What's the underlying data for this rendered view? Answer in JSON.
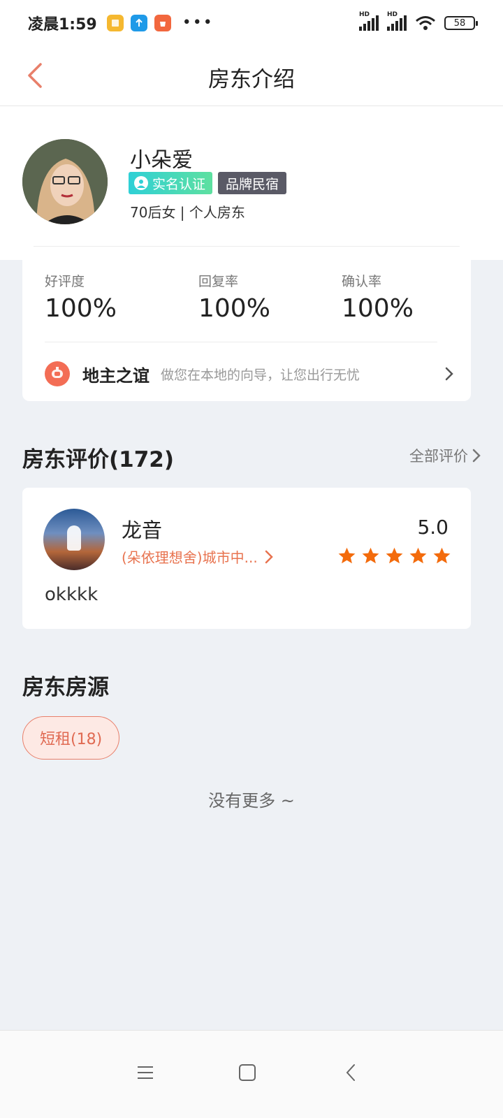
{
  "status_bar": {
    "time": "凌晨1:59",
    "dots": "•••",
    "battery": "58",
    "signal_label": "HD"
  },
  "header": {
    "title": "房东介绍"
  },
  "profile": {
    "name": "小朵爱",
    "badge_verified": "实名认证",
    "badge_brand": "品牌民宿",
    "subinfo": "70后女 | 个人房东"
  },
  "stats": [
    {
      "label": "好评度",
      "value": "100%"
    },
    {
      "label": "回复率",
      "value": "100%"
    },
    {
      "label": "确认率",
      "value": "100%"
    }
  ],
  "host_guide": {
    "title": "地主之谊",
    "desc": "做您在本地的向导，让您出行无忧"
  },
  "reviews": {
    "title": "房东评价(172)",
    "see_all": "全部评价",
    "items": [
      {
        "name": "龙音",
        "room": "(朵依理想舍)城市中...",
        "score": "5.0",
        "stars": 5,
        "text": "okkkk"
      }
    ]
  },
  "listings": {
    "title": "房东房源",
    "tag": "短租(18)",
    "no_more": "没有更多 ~"
  },
  "colors": {
    "accent": "#e8734f",
    "star": "#f36b0c",
    "verified_start": "#2fd0d6",
    "verified_end": "#5ee0a0",
    "brand_badge": "#5a5a66",
    "background": "#eef1f5"
  },
  "icons": {
    "back": "chevron-left-icon",
    "verified": "user-icon",
    "host_logo": "lantern-icon",
    "arrow": "chevron-right-icon",
    "star": "star-icon",
    "nav_menu": "menu-icon",
    "nav_home": "square-icon",
    "nav_back": "chevron-left-icon"
  }
}
